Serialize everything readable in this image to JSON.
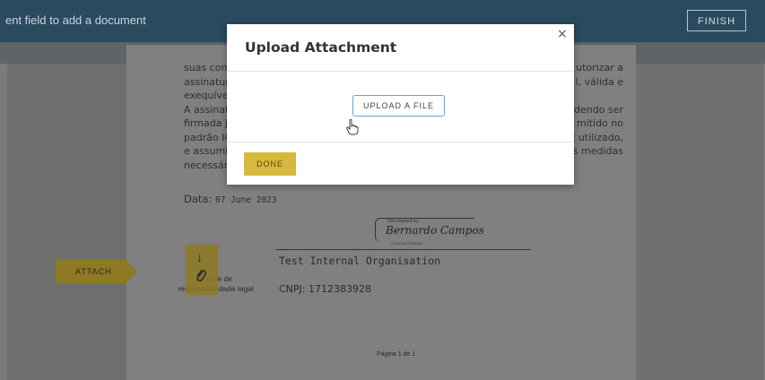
{
  "topbar": {
    "hint": "ent field to add a document",
    "finish_label": "FINISH"
  },
  "document": {
    "rows": [
      {
        "left": "suas con",
        "right": "utorizar a"
      },
      {
        "left": "assinatur",
        "right": "l, válida e"
      },
      {
        "left": "exequíve",
        "right": ""
      },
      {
        "left": "A assinat",
        "right": "dendo ser"
      },
      {
        "left": "firmada j",
        "right": "mitido no"
      },
      {
        "left": "padrão IC",
        "right": "l utilizado,"
      },
      {
        "left": "e assumi",
        "right": "s medidas"
      },
      {
        "left": "necessár",
        "right": ""
      }
    ],
    "date_label": "Data:",
    "date_value": "07 June 2023",
    "signature": {
      "docusigned_by": "DocuSigned by:",
      "name": "Bernardo Campos",
      "id": "6743A3AC59894B6"
    },
    "org": "Test Internal Organisation",
    "cnpj": "CNPJ: 1712383928",
    "responsible": "C          ante de responsabilidade legal",
    "page_label": "Página 1 de 1"
  },
  "attach": {
    "tag_label": "ATTACH",
    "arrow_icon": "↓",
    "clip_icon": "📎"
  },
  "modal": {
    "title": "Upload Attachment",
    "close": "×",
    "upload_label": "UPLOAD A FILE",
    "done_label": "DONE"
  }
}
